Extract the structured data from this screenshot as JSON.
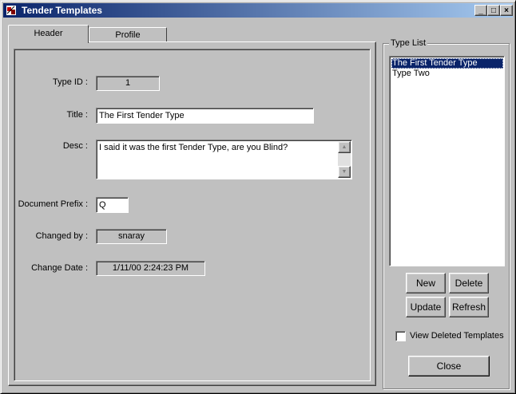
{
  "window": {
    "title": "Tender Templates",
    "minimize": "_",
    "maximize": "□",
    "close": "×"
  },
  "tabs": [
    {
      "label": "Header"
    },
    {
      "label": "Profile"
    }
  ],
  "form": {
    "type_id_label": "Type ID :",
    "type_id_value": "1",
    "title_label": "Title :",
    "title_value": "The First Tender Type",
    "desc_label": "Desc :",
    "desc_value": "I said it was the first Tender Type, are you Blind?",
    "prefix_label": "Document Prefix :",
    "prefix_value": "Q",
    "changed_by_label": "Changed by :",
    "changed_by_value": "snaray",
    "change_date_label": "Change Date :",
    "change_date_value": "1/11/00 2:24:23 PM"
  },
  "type_list": {
    "label": "Type List",
    "items": [
      {
        "label": "The First Tender Type",
        "selected": true
      },
      {
        "label": "Type Two",
        "selected": false
      }
    ]
  },
  "buttons": {
    "new": "New",
    "delete": "Delete",
    "update": "Update",
    "refresh": "Refresh",
    "close": "Close"
  },
  "view_deleted": {
    "label": "View Deleted Templates",
    "checked": false
  },
  "colors": {
    "face": "#c0c0c0",
    "titlebar_start": "#0a246a",
    "titlebar_end": "#a6caf0",
    "selection": "#0a246a"
  }
}
